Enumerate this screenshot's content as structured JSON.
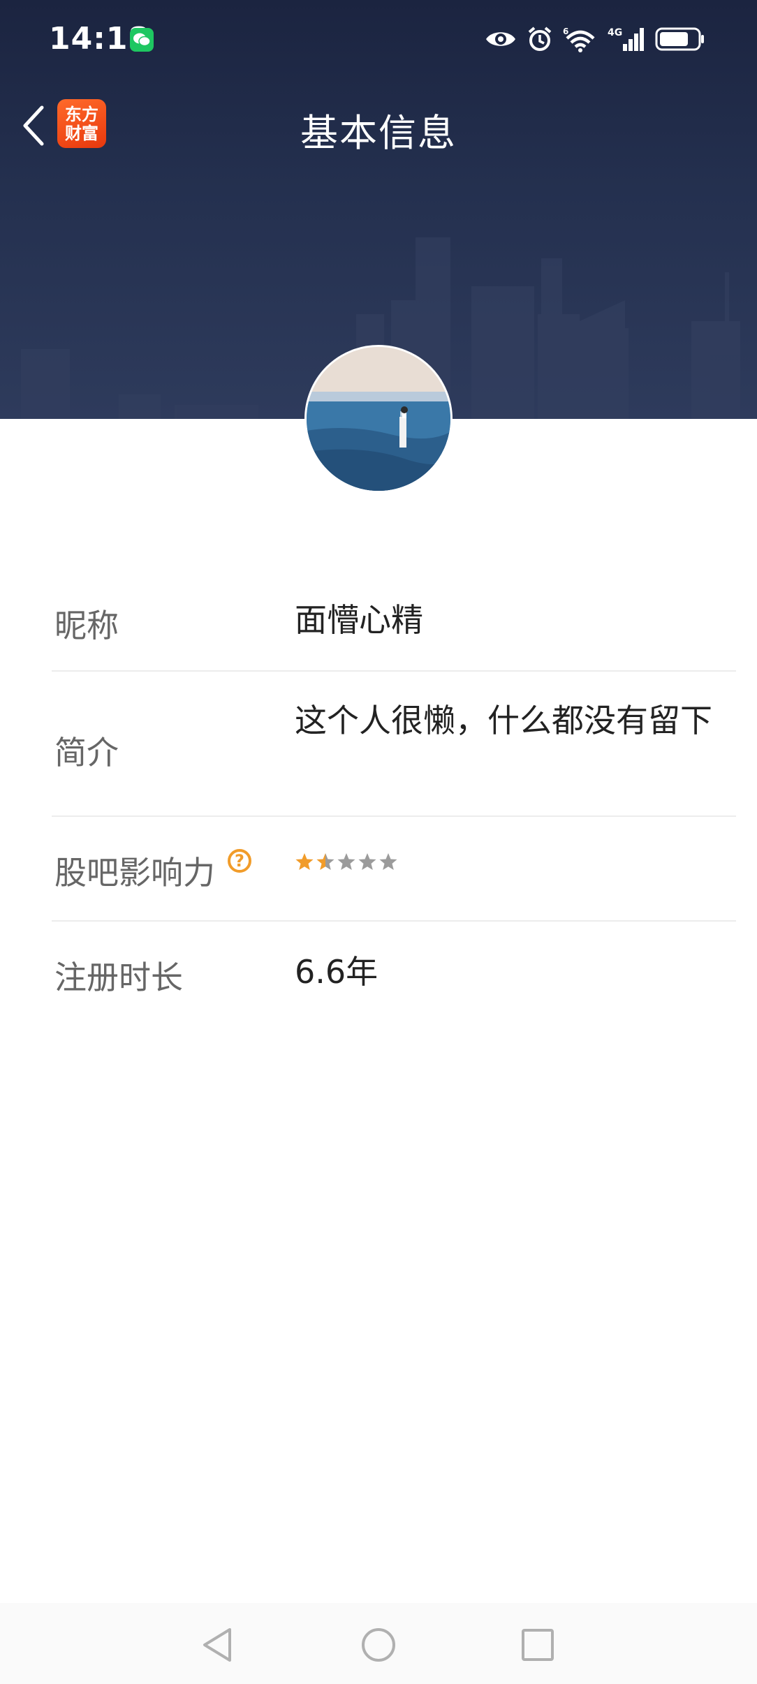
{
  "status_bar": {
    "time": "14:18",
    "icons": [
      "wechat-icon",
      "eye-icon",
      "alarm-icon",
      "wifi-icon",
      "signal-4g-icon",
      "battery-icon"
    ],
    "network_label": "4G",
    "wifi_badge": "6"
  },
  "navbar": {
    "title": "基本信息",
    "logo_line1": "东方",
    "logo_line2": "财富",
    "back_icon": "chevron-left-icon"
  },
  "profile": {
    "avatar": "avatar-photo"
  },
  "info": {
    "nickname_label": "昵称",
    "nickname_value": "面懵心精",
    "bio_label": "简介",
    "bio_value": "这个人很懒，什么都没有留下",
    "influence_label": "股吧影响力",
    "influence_help": "?",
    "influence_rating": 1.5,
    "influence_max": 5,
    "register_label": "注册时长",
    "register_value": "6.6年"
  },
  "colors": {
    "star_active": "#f19c2a",
    "star_inactive": "#9b9b9b",
    "header_bg": "#1e2844",
    "logo_bg": "#f0511a"
  },
  "system_nav": [
    "back-triangle-icon",
    "home-circle-icon",
    "recents-square-icon"
  ]
}
